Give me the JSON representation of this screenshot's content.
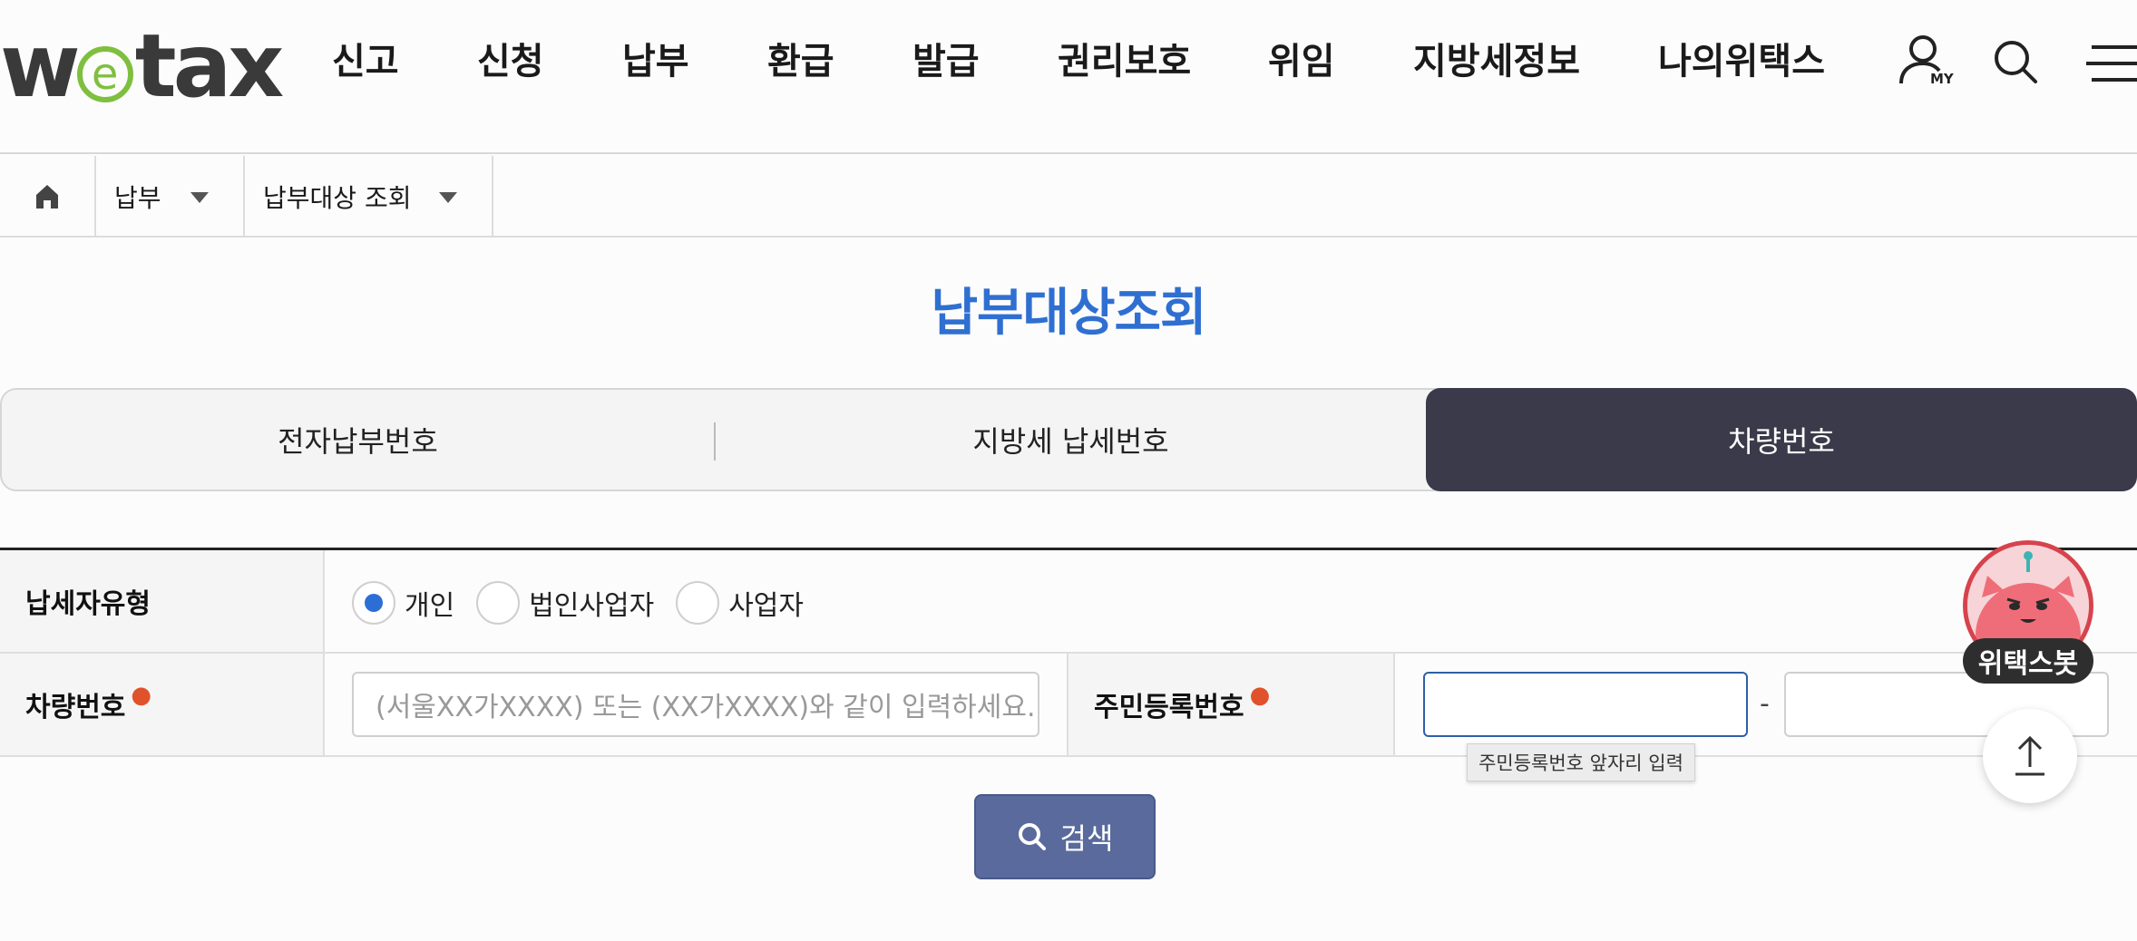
{
  "header": {
    "logo_w": "w",
    "logo_e": "e",
    "logo_rest": "tax",
    "nav": [
      "신고",
      "신청",
      "납부",
      "환급",
      "발급",
      "권리보호",
      "위임",
      "지방세정보",
      "나의위택스"
    ],
    "my_label": "MY",
    "icons": [
      "user-my-icon",
      "search-icon",
      "menu-icon"
    ]
  },
  "breadcrumb": {
    "home_icon": "home-icon",
    "level1": "납부",
    "level2": "납부대상 조회"
  },
  "page": {
    "title": "납부대상조회"
  },
  "tabs": [
    {
      "label": "전자납부번호",
      "active": false
    },
    {
      "label": "지방세 납세번호",
      "active": false
    },
    {
      "label": "차량번호",
      "active": true
    }
  ],
  "form": {
    "taxpayer_type_label": "납세자유형",
    "taxpayer_types": [
      {
        "label": "개인",
        "selected": true
      },
      {
        "label": "법인사업자",
        "selected": false
      },
      {
        "label": "사업자",
        "selected": false
      }
    ],
    "vehicle_label": "차량번호",
    "vehicle_placeholder": "(서울XX가XXXX) 또는 (XX가XXXX)와 같이 입력하세요.",
    "rrn_label": "주민등록번호",
    "rrn_front_value": "",
    "rrn_back_value": "",
    "dash": "-",
    "tooltip": "주민등록번호 앞자리 입력",
    "search_label": "검색"
  },
  "floating": {
    "bot_label": "위택스봇"
  },
  "colors": {
    "accent_blue": "#2f6fd1",
    "active_tab_bg": "#3a3a4a",
    "search_btn": "#5a6a9c",
    "required_dot": "#e0522c",
    "logo_green": "#7fbf3f",
    "bot_ring": "#d7434d"
  }
}
